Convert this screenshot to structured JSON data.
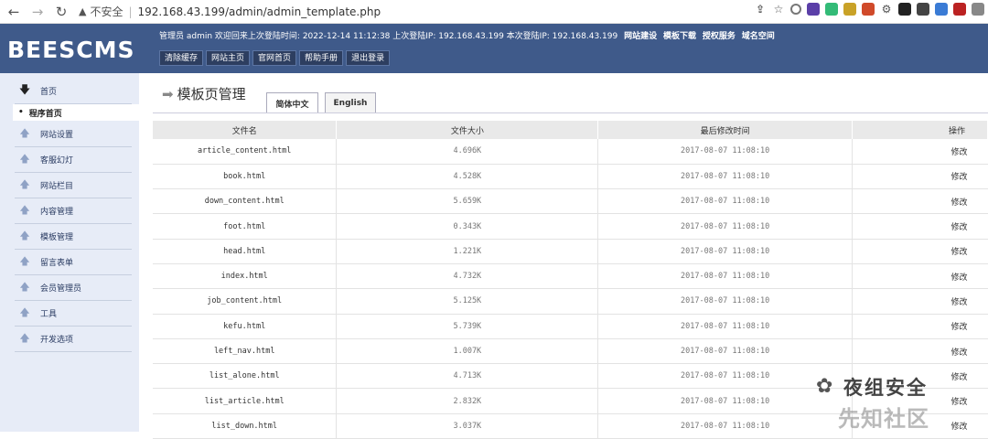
{
  "browser": {
    "insecure": "不安全",
    "separator": "|",
    "url": "192.168.43.199/admin/admin_template.php"
  },
  "header": {
    "logo": "BEESCMS",
    "userinfo": "管理员 admin 欢迎回来上次登陆时间: 2022-12-14 11:12:38 上次登陆IP: 192.168.43.199 本次登陆IP: 192.168.43.199",
    "links": [
      "网站建设",
      "模板下载",
      "授权服务",
      "域名空间"
    ],
    "buttons": [
      "清除缓存",
      "网站主页",
      "官网首页",
      "帮助手册",
      "退出登录"
    ]
  },
  "sidebar": {
    "home": "首页",
    "active": "程序首页",
    "items": [
      "网站设置",
      "客服幻灯",
      "网站栏目",
      "内容管理",
      "模板管理",
      "留言表单",
      "会员管理员",
      "工具",
      "开发选项"
    ]
  },
  "main": {
    "title": "模板页管理",
    "tabs": [
      "简体中文",
      "English"
    ],
    "columns": [
      "文件名",
      "文件大小",
      "最后修改时间",
      "操作"
    ],
    "rows": [
      {
        "name": "article_content.html",
        "size": "4.696K",
        "time": "2017-08-07 11:08:10",
        "op": "修改"
      },
      {
        "name": "book.html",
        "size": "4.528K",
        "time": "2017-08-07 11:08:10",
        "op": "修改"
      },
      {
        "name": "down_content.html",
        "size": "5.659K",
        "time": "2017-08-07 11:08:10",
        "op": "修改"
      },
      {
        "name": "foot.html",
        "size": "0.343K",
        "time": "2017-08-07 11:08:10",
        "op": "修改"
      },
      {
        "name": "head.html",
        "size": "1.221K",
        "time": "2017-08-07 11:08:10",
        "op": "修改"
      },
      {
        "name": "index.html",
        "size": "4.732K",
        "time": "2017-08-07 11:08:10",
        "op": "修改"
      },
      {
        "name": "job_content.html",
        "size": "5.125K",
        "time": "2017-08-07 11:08:10",
        "op": "修改"
      },
      {
        "name": "kefu.html",
        "size": "5.739K",
        "time": "2017-08-07 11:08:10",
        "op": "修改"
      },
      {
        "name": "left_nav.html",
        "size": "1.007K",
        "time": "2017-08-07 11:08:10",
        "op": "修改"
      },
      {
        "name": "list_alone.html",
        "size": "4.713K",
        "time": "2017-08-07 11:08:10",
        "op": "修改"
      },
      {
        "name": "list_article.html",
        "size": "2.832K",
        "time": "2017-08-07 11:08:10",
        "op": "修改"
      },
      {
        "name": "list_down.html",
        "size": "3.037K",
        "time": "2017-08-07 11:08:10",
        "op": "修改"
      }
    ]
  },
  "watermark": {
    "line1": "夜组安全",
    "line2": "先知社区"
  },
  "colors": {
    "header_bg": "#3f5a8a",
    "sidebar_bg": "#e7ecf7"
  }
}
